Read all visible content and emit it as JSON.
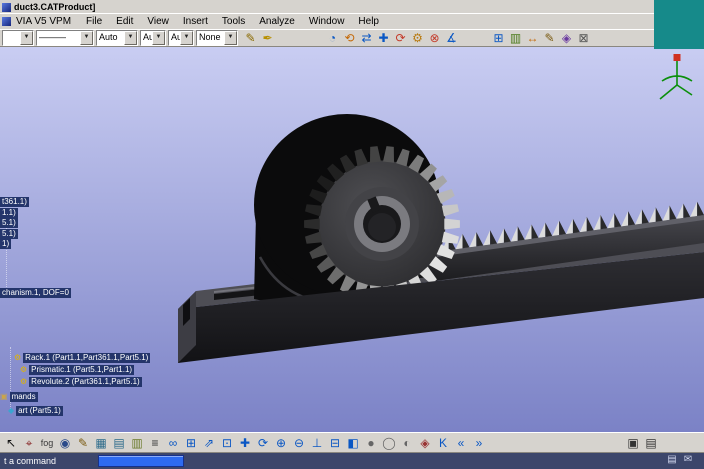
{
  "window": {
    "title": "duct3.CATProduct]"
  },
  "menubar": {
    "brand": "VIA V5 VPM",
    "menus": [
      "File",
      "Edit",
      "View",
      "Insert",
      "Tools",
      "Analyze",
      "Window",
      "Help"
    ]
  },
  "toolbar": {
    "combos": [
      {
        "name": "style-combo",
        "value": ""
      },
      {
        "name": "line-type-combo",
        "value": "———"
      },
      {
        "name": "line-weight-combo",
        "value": "Auto"
      },
      {
        "name": "point-type-combo",
        "value": "Aut"
      },
      {
        "name": "render-style-combo",
        "value": "Aut"
      },
      {
        "name": "layer-combo",
        "value": "None"
      }
    ],
    "icons_a": [
      {
        "name": "sketch-icon",
        "glyph": "✎",
        "color": "#8a6a00"
      },
      {
        "name": "paint-icon",
        "glyph": "✒",
        "color": "#b89000"
      }
    ],
    "icons_b": [
      {
        "name": "simulation-icon",
        "glyph": "◔",
        "color": "#0a57c4"
      },
      {
        "name": "replay-icon",
        "glyph": "⟲",
        "color": "#c46a0a"
      },
      {
        "name": "shuttle-icon",
        "glyph": "⇄",
        "color": "#0a57c4"
      },
      {
        "name": "manipulate-icon",
        "glyph": "✚",
        "color": "#0a57c4"
      },
      {
        "name": "rotate-tool-icon",
        "glyph": "⟳",
        "color": "#c43a2a"
      },
      {
        "name": "mechanism-gear-icon",
        "glyph": "⚙",
        "color": "#b87a10"
      },
      {
        "name": "clash-icon",
        "glyph": "⊗",
        "color": "#c43a2a"
      },
      {
        "name": "measure-icon",
        "glyph": "∡",
        "color": "#0a57c4"
      }
    ],
    "icons_c": [
      {
        "name": "frame-icon",
        "glyph": "⊞",
        "color": "#0a57c4"
      },
      {
        "name": "section-icon",
        "glyph": "▥",
        "color": "#4a7a1a"
      },
      {
        "name": "distance-icon",
        "glyph": "↔",
        "color": "#c46a0a"
      },
      {
        "name": "annotation-icon",
        "glyph": "✎",
        "color": "#7a5a10"
      },
      {
        "name": "swap-view-icon",
        "glyph": "◈",
        "color": "#6a3aa0"
      },
      {
        "name": "tools-icon",
        "glyph": "⊠",
        "color": "#555555"
      }
    ]
  },
  "scene": {
    "bg_top": "#c9cdf2",
    "bg_bottom": "#7b82c6",
    "housing": "#0b0b0c",
    "gear_face_light": "#4f4f53",
    "gear_face_dark": "#2b2b2e",
    "hub_outer": "#434347",
    "hub_ring": "#7b7b80",
    "hub_hole": "#19191b",
    "rack_light": "#dcdcdc",
    "rack_dark": "#2a2a2c",
    "rack_top": "#606068",
    "base_surface": "#4e4e55",
    "base_front_top": "#2e2e33",
    "base_front_bottom": "#121215",
    "base_end": "#3d3d44",
    "groove": "#141416",
    "groove_hi": "#74747c"
  },
  "tree": {
    "items": [
      {
        "label": "t361.1)",
        "icon": null
      },
      {
        "label": "1.1)",
        "icon": null
      },
      {
        "label": "5.1)",
        "icon": null
      },
      {
        "label": "5.1)",
        "icon": null
      },
      {
        "label": "1)",
        "icon": null
      },
      {
        "label": "chanism.1, DOF=0",
        "icon": null
      },
      {
        "label": "Rack.1 (Part1.1,Part361.1,Part5.1)",
        "icon": "joint-icon",
        "icon_glyph": "⚙",
        "icon_color": "#e0b400"
      },
      {
        "label": "Prismatic.1 (Part5.1,Part1.1)",
        "icon": "joint-icon",
        "icon_glyph": "⚙",
        "icon_color": "#e0b400"
      },
      {
        "label": "Revolute.2 (Part361.1,Part5.1)",
        "icon": "joint-icon",
        "icon_glyph": "⚙",
        "icon_color": "#e0b400"
      },
      {
        "label": "mands",
        "icon": "folder-icon",
        "icon_glyph": "▣",
        "icon_color": "#caa54a"
      },
      {
        "label": "art (Part5.1)",
        "icon": "part-icon",
        "icon_glyph": "◆",
        "icon_color": "#3aa5d0"
      }
    ]
  },
  "bottombar": {
    "icons": [
      {
        "name": "select-icon",
        "glyph": "↖",
        "color": "#101010"
      },
      {
        "name": "target-icon",
        "glyph": "⌖",
        "color": "#8a2a2a"
      },
      {
        "name": "fog-icon",
        "glyph": "fog",
        "color": "#3a3a3a"
      },
      {
        "name": "view-eye-icon",
        "glyph": "◉",
        "color": "#2a4a8a"
      },
      {
        "name": "sketcher-icon",
        "glyph": "✎",
        "color": "#7a5a10"
      },
      {
        "name": "grid-icon",
        "glyph": "▦",
        "color": "#2a6a8a"
      },
      {
        "name": "table-icon",
        "glyph": "▤",
        "color": "#2a6a8a"
      },
      {
        "name": "sheet-icon",
        "glyph": "▥",
        "color": "#6a7a2a"
      },
      {
        "name": "list-icon",
        "glyph": "≡",
        "color": "#333333"
      },
      {
        "name": "link-icon",
        "glyph": "∞",
        "color": "#0a57c4"
      },
      {
        "name": "join-icon",
        "glyph": "⊞",
        "color": "#0a57c4"
      },
      {
        "name": "fly-icon",
        "glyph": "⇗",
        "color": "#0a57c4"
      },
      {
        "name": "fit-all-icon",
        "glyph": "⊡",
        "color": "#0a57c4"
      },
      {
        "name": "pan-icon",
        "glyph": "✚",
        "color": "#0a57c4"
      },
      {
        "name": "rotate-icon",
        "glyph": "⟳",
        "color": "#0a57c4"
      },
      {
        "name": "zoom-in-icon",
        "glyph": "⊕",
        "color": "#0a57c4"
      },
      {
        "name": "zoom-out-icon",
        "glyph": "⊖",
        "color": "#0a57c4"
      },
      {
        "name": "normal-view-icon",
        "glyph": "⊥",
        "color": "#0a57c4"
      },
      {
        "name": "multi-view-icon",
        "glyph": "⊟",
        "color": "#0a57c4"
      },
      {
        "name": "half-shade-icon",
        "glyph": "◧",
        "color": "#0a57c4"
      },
      {
        "name": "shaded-icon",
        "glyph": "●",
        "color": "#666666"
      },
      {
        "name": "wireframe-icon",
        "glyph": "◯",
        "color": "#666666"
      },
      {
        "name": "hidden-line-icon",
        "glyph": "◐",
        "color": "#666666"
      },
      {
        "name": "compass-icon",
        "glyph": "◈",
        "color": "#993333"
      },
      {
        "name": "knowledge-icon",
        "glyph": "K",
        "color": "#0a57c4"
      },
      {
        "name": "back-icon",
        "glyph": "«",
        "color": "#0a57c4"
      },
      {
        "name": "forward-icon",
        "glyph": "»",
        "color": "#0a57c4"
      }
    ],
    "right_icons": [
      {
        "name": "monitor-icon",
        "glyph": "▣",
        "color": "#333333"
      },
      {
        "name": "display-icon",
        "glyph": "▤",
        "color": "#333333"
      }
    ]
  },
  "status": {
    "prompt": "t a command",
    "field_value": "",
    "icons": [
      {
        "name": "doc-status-icon",
        "glyph": "▤"
      },
      {
        "name": "mail-status-icon",
        "glyph": "✉"
      }
    ]
  }
}
